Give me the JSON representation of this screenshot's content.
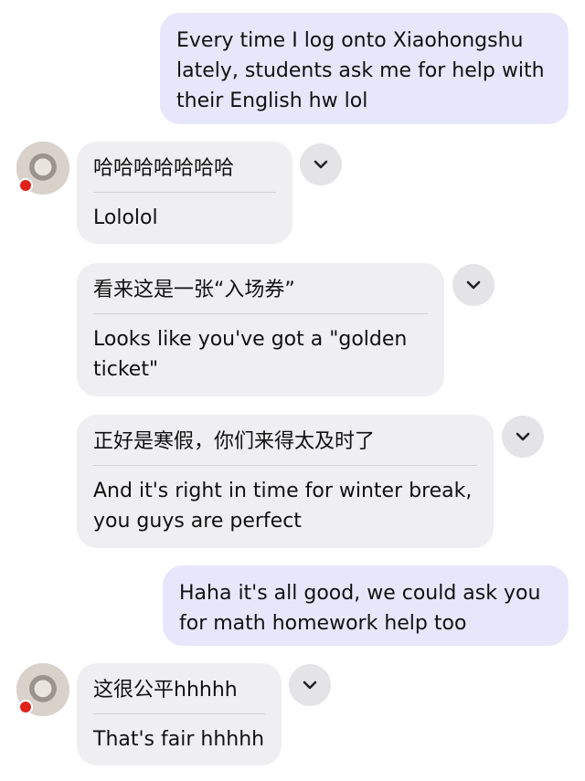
{
  "colors": {
    "outgoing_bubble": "#e8e6fb",
    "incoming_bubble": "#efeff1",
    "chevron_bg": "#e4e4e7",
    "flag": "#e0221a"
  },
  "messages": [
    {
      "direction": "outgoing",
      "text": "Every time I log onto Xiaohongshu lately, students ask me for help with their English hw lol"
    },
    {
      "direction": "incoming",
      "original": "哈哈哈哈哈哈哈",
      "translation": "Lololol",
      "icon": "chevron-down-icon"
    },
    {
      "direction": "incoming",
      "original": "看来这是一张“入场券”",
      "translation": "Looks like you've got a \"golden ticket\"",
      "icon": "chevron-down-icon"
    },
    {
      "direction": "incoming",
      "original": "正好是寒假，你们来得太及时了",
      "translation": "And it's right in time for winter break, you guys are perfect",
      "icon": "chevron-down-icon"
    },
    {
      "direction": "outgoing",
      "text": "Haha it's all good, we could ask you for math homework help too"
    },
    {
      "direction": "incoming",
      "original": "这很公平hhhhh",
      "translation": "That's fair hhhhh",
      "icon": "chevron-down-icon"
    }
  ]
}
